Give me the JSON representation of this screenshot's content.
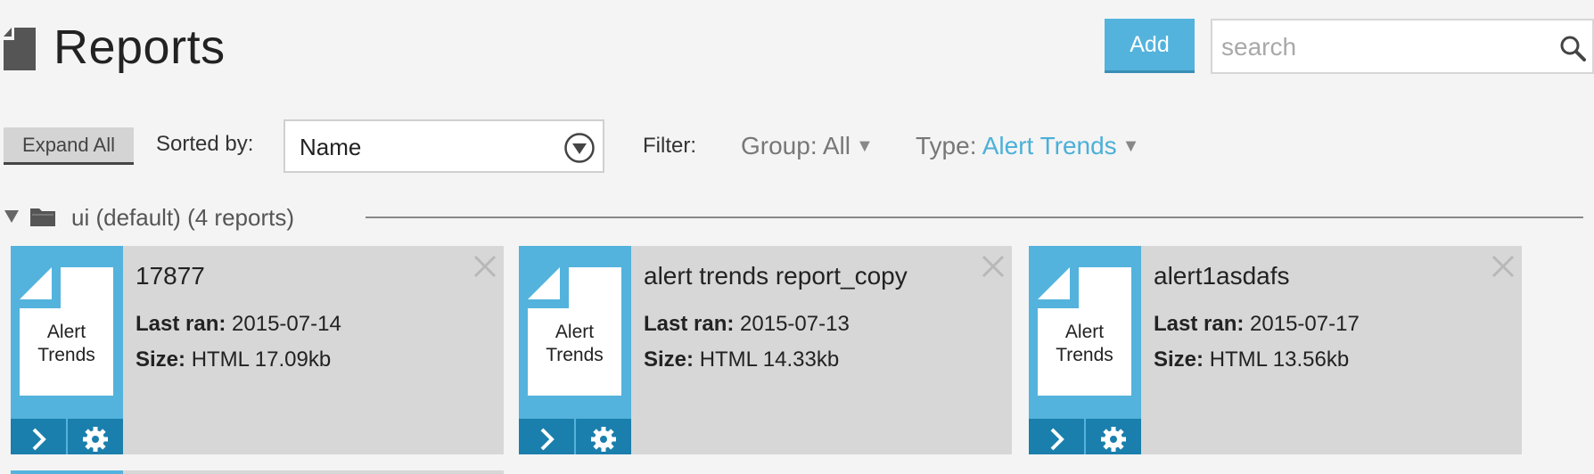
{
  "header": {
    "title": "Reports",
    "add_label": "Add",
    "search_placeholder": "search"
  },
  "toolbar": {
    "expand_label": "Expand All",
    "sorted_by_label": "Sorted by:",
    "sort_value": "Name",
    "filter_label": "Filter:",
    "group_filter_label": "Group:",
    "group_filter_value": "All",
    "type_filter_label": "Type:",
    "type_filter_value": "Alert Trends"
  },
  "group": {
    "label": "ui (default) (4 reports)"
  },
  "reports": [
    {
      "type_label_line1": "Alert",
      "type_label_line2": "Trends",
      "name": "17877",
      "last_ran_label": "Last ran:",
      "last_ran": "2015-07-14",
      "size_label": "Size:",
      "size": "HTML 17.09kb"
    },
    {
      "type_label_line1": "Alert",
      "type_label_line2": "Trends",
      "name": "alert trends report_copy",
      "last_ran_label": "Last ran:",
      "last_ran": "2015-07-13",
      "size_label": "Size:",
      "size": "HTML 14.33kb"
    },
    {
      "type_label_line1": "Alert",
      "type_label_line2": "Trends",
      "name": "alert1asdafs",
      "last_ran_label": "Last ran:",
      "last_ran": "2015-07-17",
      "size_label": "Size:",
      "size": "HTML 13.56kb"
    }
  ],
  "colors": {
    "accent": "#53b3dc",
    "accent_dark": "#1a7fac",
    "card_bg": "#d7d7d7",
    "type_value": "#4bb0d8"
  },
  "icons": {
    "page": "document-icon",
    "search": "search-icon",
    "sort": "chevron-down-circle-icon",
    "group_toggle": "triangle-down-icon",
    "folder": "folder-icon",
    "run": "chevron-right-icon",
    "settings": "gear-icon",
    "close": "close-icon"
  }
}
